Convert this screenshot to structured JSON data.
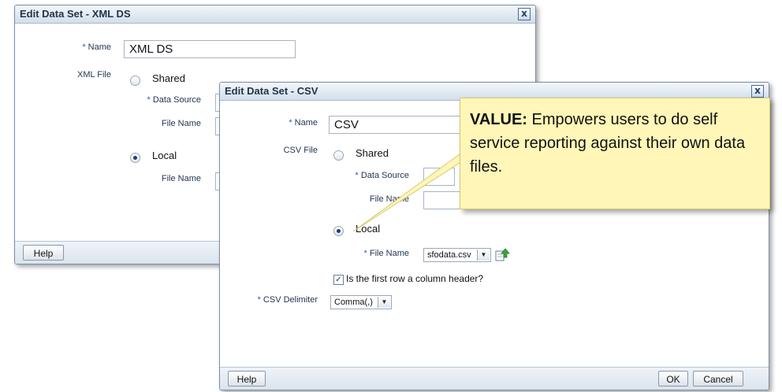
{
  "xml_dialog": {
    "title": "Edit Data Set - XML DS",
    "close_label": "x",
    "name_label": "Name",
    "name_value": "XML DS",
    "file_label": "XML File",
    "shared_label": "Shared",
    "data_source_label": "Data Source",
    "file_name_label": "File Name",
    "local_label": "Local",
    "local_file_name_label": "File Name",
    "help_label": "Help"
  },
  "csv_dialog": {
    "title": "Edit Data Set - CSV",
    "close_label": "x",
    "name_label": "Name",
    "name_value": "CSV",
    "file_label": "CSV File",
    "shared_label": "Shared",
    "data_source_label": "Data Source",
    "file_name_label": "File Name",
    "local_label": "Local",
    "local_file_name_label": "File Name",
    "local_file_value": "sfodata.csv",
    "header_checkbox_label": "Is the first row a column header?",
    "header_checked": true,
    "delimiter_label": "CSV Delimiter",
    "delimiter_value": "Comma(,)",
    "help_label": "Help",
    "ok_label": "OK",
    "cancel_label": "Cancel"
  },
  "callout": {
    "heading": "VALUE:",
    "text": "Empowers users to do self service reporting against their own data files."
  },
  "colors": {
    "titlebar": "#d2deea",
    "callout_bg": "#fff6b8",
    "label": "#1f3450",
    "required_star": "#2a5db0"
  },
  "icons": {
    "upload": "upload-icon",
    "search": "search-icon",
    "close": "close-icon"
  }
}
